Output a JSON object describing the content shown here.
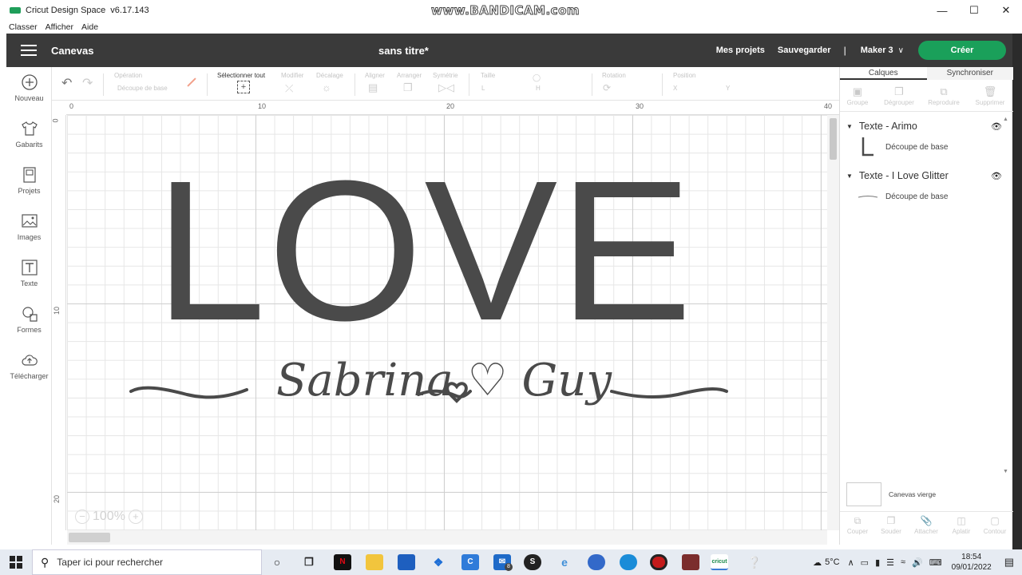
{
  "window": {
    "title": "Cricut Design Space",
    "version": "v6.17.143",
    "watermark": "www.BANDICAM.com"
  },
  "menu": [
    "Classer",
    "Afficher",
    "Aide"
  ],
  "header": {
    "canvas_label": "Canevas",
    "doc_title": "sans titre*",
    "my_projects": "Mes projets",
    "save": "Sauvegarder",
    "separator": "|",
    "machine": "Maker 3",
    "create": "Créer"
  },
  "sidebar": [
    {
      "label": "Nouveau",
      "icon": "plus-circle-icon"
    },
    {
      "label": "Gabarits",
      "icon": "tshirt-icon"
    },
    {
      "label": "Projets",
      "icon": "projects-icon"
    },
    {
      "label": "Images",
      "icon": "image-icon"
    },
    {
      "label": "Texte",
      "icon": "text-icon"
    },
    {
      "label": "Formes",
      "icon": "shapes-icon"
    },
    {
      "label": "Télécharger",
      "icon": "upload-cloud-icon"
    }
  ],
  "toolbar": {
    "operation_label": "Opération",
    "operation_value": "Découpe de base",
    "select_all": "Sélectionner tout",
    "modify": "Modifier",
    "offset": "Décalage",
    "align": "Aligner",
    "arrange": "Arranger",
    "symmetry": "Symétrie",
    "size": "Taille",
    "size_w": "L",
    "size_h": "H",
    "rotation": "Rotation",
    "position": "Position",
    "pos_x": "X",
    "pos_y": "Y"
  },
  "ruler": {
    "top": [
      "0",
      "10",
      "20",
      "30",
      "40"
    ],
    "left": [
      "0",
      "10",
      "20"
    ]
  },
  "design": {
    "main_text": "LOVE",
    "script_text": "Sabrina ♡ Guy",
    "text_color": "#4a4a4a"
  },
  "zoom": {
    "value": "100%",
    "minus": "−",
    "plus": "+"
  },
  "panel": {
    "tabs": [
      "Calques",
      "Synchroniser"
    ],
    "tools": [
      "Groupe",
      "Dégrouper",
      "Reproduire",
      "Supprimer"
    ],
    "layers": [
      {
        "title": "Texte - Arimo",
        "row_label": "Découpe de base"
      },
      {
        "title": "Texte - I Love Glitter",
        "row_label": "Découpe de base"
      }
    ],
    "blank_canvas": "Canevas vierge",
    "bottom_tools": [
      "Couper",
      "Souder",
      "Attacher",
      "Aplatir",
      "Contour"
    ]
  },
  "taskbar": {
    "search_placeholder": "Taper ici pour rechercher",
    "temperature": "5°C",
    "time": "18:54",
    "date": "09/01/2022",
    "mail_badge": "8"
  },
  "colors": {
    "header_bg": "#3a3a3a",
    "create_green": "#1aa05a"
  }
}
